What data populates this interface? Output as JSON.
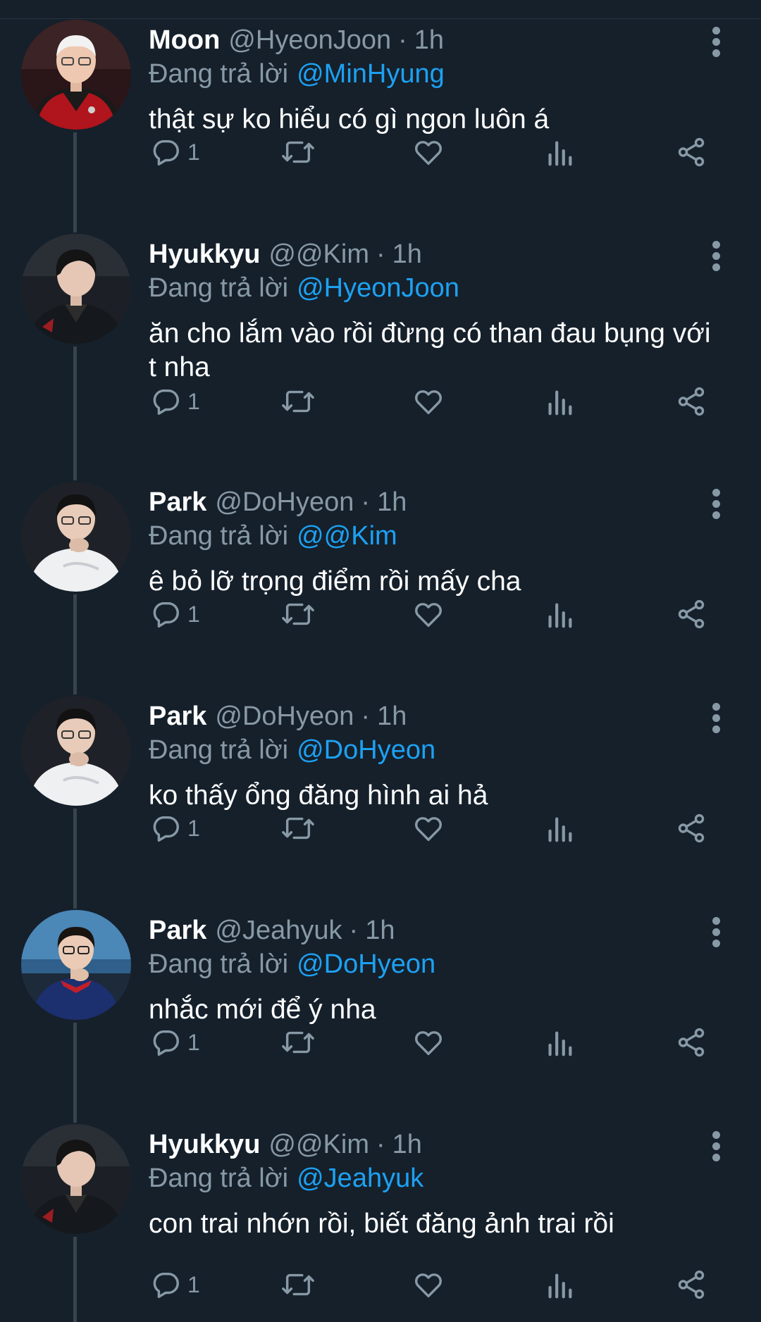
{
  "colors": {
    "background": "#15202b",
    "text": "#ffffff",
    "secondary": "#8899a6",
    "link": "#1da1f2",
    "thread_line": "#38444d"
  },
  "labels": {
    "reply_prefix": "Đang trả lời",
    "dot": "·"
  },
  "icons": {
    "reply": "reply-icon",
    "retweet": "retweet-icon",
    "like": "like-icon",
    "views": "views-icon",
    "share": "share-icon",
    "more": "more-icon"
  },
  "tweets": [
    {
      "display_name": "Moon",
      "handle": "@HyeonJoon",
      "time": "1h",
      "reply_to": "@MinHyung",
      "text": "thật sự ko hiểu có gì ngon luôn á",
      "reply_count": "1",
      "avatar": "avatar-red-jersey"
    },
    {
      "display_name": "Hyukkyu",
      "handle": "@@Kim",
      "time": "1h",
      "reply_to": "@HyeonJoon",
      "text": "ăn cho lắm vào rồi đừng có than đau bụng với t nha",
      "reply_count": "1",
      "avatar": "avatar-dark-jacket"
    },
    {
      "display_name": "Park",
      "handle": "@DoHyeon",
      "time": "1h",
      "reply_to": "@@Kim",
      "text": "ê bỏ lỡ trọng điểm rồi mấy cha",
      "reply_count": "1",
      "avatar": "avatar-white-hoodie"
    },
    {
      "display_name": "Park",
      "handle": "@DoHyeon",
      "time": "1h",
      "reply_to": "@DoHyeon",
      "text": "ko thấy ổng đăng hình ai hả",
      "reply_count": "1",
      "avatar": "avatar-white-hoodie"
    },
    {
      "display_name": "Park",
      "handle": "@Jeahyuk",
      "time": "1h",
      "reply_to": "@DoHyeon",
      "text": "nhắc mới để ý nha",
      "reply_count": "1",
      "avatar": "avatar-blue-jacket"
    },
    {
      "display_name": "Hyukkyu",
      "handle": "@@Kim",
      "time": "1h",
      "reply_to": "@Jeahyuk",
      "text": "con trai nhớn rồi, biết đăng ảnh trai rồi",
      "reply_count": "1",
      "avatar": "avatar-dark-jacket"
    }
  ]
}
